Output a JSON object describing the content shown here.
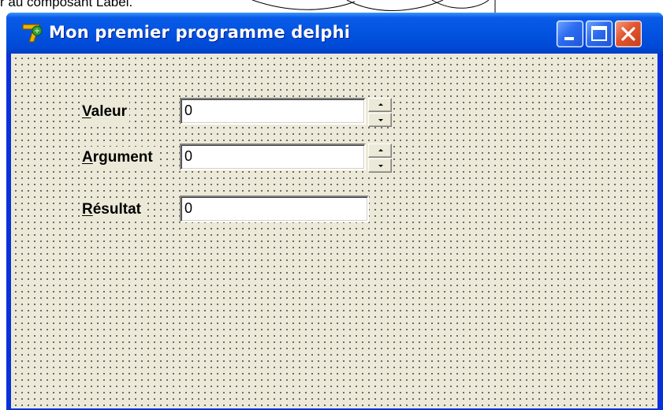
{
  "page": {
    "top_fragment": "r au composant Label."
  },
  "window": {
    "title": "Mon premier programme delphi",
    "icon": "delphi-7-icon",
    "buttons": {
      "minimize": "minimize-icon",
      "maximize": "maximize-icon",
      "close": "close-icon"
    }
  },
  "form": {
    "fields": [
      {
        "label_accel": "V",
        "label_rest": "aleur",
        "value": "0",
        "has_spin": true
      },
      {
        "label_accel": "A",
        "label_rest": "rgument",
        "value": "0",
        "has_spin": true
      },
      {
        "label_accel": "R",
        "label_rest": "ésultat",
        "value": "0",
        "has_spin": false
      }
    ]
  },
  "colors": {
    "titlebar": "#0253e0",
    "client_bg": "#ece9d8",
    "close_button": "#e2542c"
  }
}
